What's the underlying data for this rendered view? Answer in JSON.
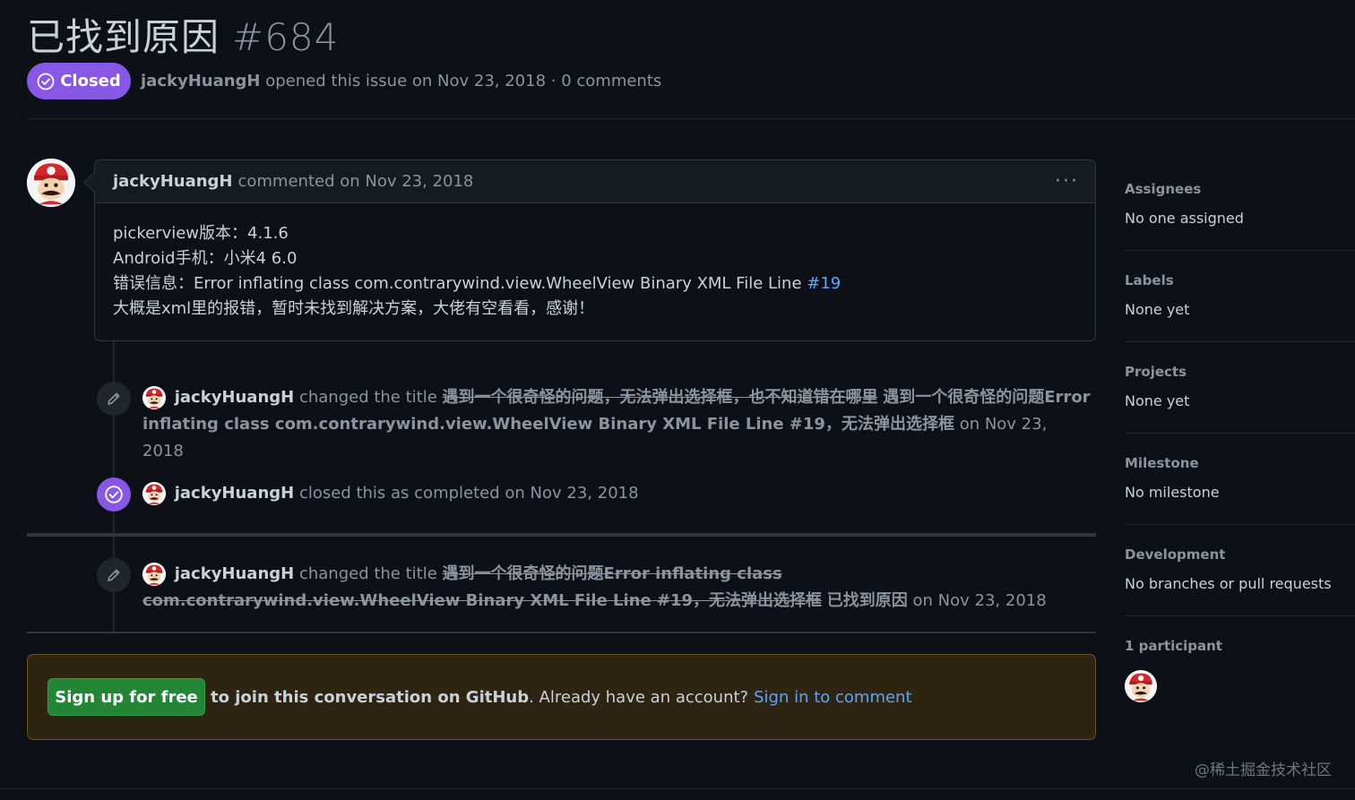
{
  "issue": {
    "title": "已找到原因",
    "number": "#684",
    "state": "Closed",
    "author": "jackyHuangH",
    "meta_rest": "opened this issue on Nov 23, 2018 · 0 comments"
  },
  "comment": {
    "author": "jackyHuangH",
    "when": "commented on Nov 23, 2018",
    "menu": "···",
    "lines": [
      "pickerview版本：4.1.6",
      "Android手机：小米4 6.0",
      "大概是xml里的报错，暂时未找到解决方案，大佬有空看看，感谢！"
    ],
    "error_line_prefix": "错误信息：Error inflating class com.contrarywind.view.WheelView Binary XML File Line ",
    "error_link": "#19"
  },
  "events": [
    {
      "author": "jackyHuangH",
      "action": "changed the title",
      "old_title": "遇到一个很奇怪的问题，无法弹出选择框，也不知道错在哪里",
      "new_title": "遇到一个很奇怪的问题Error inflating class com.contrarywind.view.WheelView Binary XML File Line #19，无法弹出选择框",
      "when": "on Nov 23, 2018"
    },
    {
      "author": "jackyHuangH",
      "action": "closed this as completed",
      "when": "on Nov 23, 2018"
    },
    {
      "author": "jackyHuangH",
      "action": "changed the title",
      "old_title": "遇到一个很奇怪的问题Error inflating class com.contrarywind.view.WheelView Binary XML File Line #19，无法弹出选择框",
      "new_title": "已找到原因",
      "when": "on Nov 23, 2018"
    }
  ],
  "signup": {
    "button": "Sign up for free",
    "text_strong": "to join this conversation on GitHub",
    "text_rest": ". Already have an account?",
    "link": "Sign in to comment"
  },
  "sidebar": {
    "assignees": {
      "heading": "Assignees",
      "value": "No one assigned"
    },
    "labels": {
      "heading": "Labels",
      "value": "None yet"
    },
    "projects": {
      "heading": "Projects",
      "value": "None yet"
    },
    "milestone": {
      "heading": "Milestone",
      "value": "No milestone"
    },
    "development": {
      "heading": "Development",
      "value": "No branches or pull requests"
    },
    "participants": {
      "heading": "1 participant"
    }
  },
  "watermark": "@稀土掘金技术社区",
  "colors": {
    "background": "#0d1117",
    "closed_purple": "#8957e5",
    "link_blue": "#58a6ff",
    "signup_green": "#238636"
  },
  "icons": {
    "state": "check-circle-icon",
    "rename": "pencil-icon",
    "closed_event": "check-circle-icon",
    "menu": "kebab-icon"
  }
}
